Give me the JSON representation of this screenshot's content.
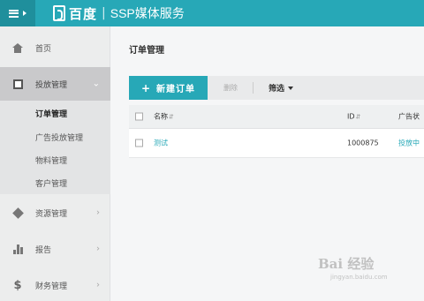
{
  "header": {
    "brand_name": "百度",
    "separator": "|",
    "product_name": "SSP媒体服务"
  },
  "sidebar": {
    "items": [
      {
        "label": "首页",
        "icon": "home-icon"
      },
      {
        "label": "投放管理",
        "icon": "campaign-icon",
        "active": true
      },
      {
        "label": "资源管理",
        "icon": "cube-icon"
      },
      {
        "label": "报告",
        "icon": "bar-chart-icon"
      },
      {
        "label": "财务管理",
        "icon": "dollar-icon"
      }
    ],
    "sub_items": [
      {
        "label": "订单管理",
        "current": true
      },
      {
        "label": "广告投放管理"
      },
      {
        "label": "物料管理"
      },
      {
        "label": "客户管理"
      }
    ]
  },
  "main": {
    "title": "订单管理",
    "toolbar": {
      "new_order_label": "新建订单",
      "delete_label": "删除",
      "filter_label": "筛选"
    },
    "table": {
      "columns": [
        "名称",
        "ID",
        "广告状"
      ],
      "rows": [
        {
          "name": "测试",
          "id": "1000875",
          "status": "投放中"
        }
      ]
    }
  },
  "watermark": {
    "line1": "Bai 经验",
    "line2": "jingyan.baidu.com"
  },
  "colors": {
    "accent": "#27a8b7",
    "accent_dark": "#1f8f9c",
    "sidebar_active": "#c9c9cb"
  }
}
